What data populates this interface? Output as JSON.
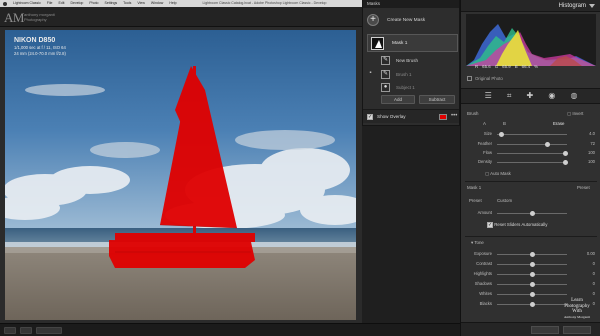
{
  "menubar": {
    "items": [
      "Lightroom Classic",
      "File",
      "Edit",
      "Develop",
      "Photo",
      "Settings",
      "Tools",
      "View",
      "Window",
      "Help"
    ],
    "window_title": "Lightroom Classic Catalog.lrcat - Adobe Photoshop Lightroom Classic - Develop"
  },
  "identity": {
    "mark": "AM",
    "name_line1": "anthony morganti",
    "name_line2": "Photography"
  },
  "photo_info": {
    "camera": "NIKON D850",
    "exposure": "1/1,000 sec at f / 11, ISO 64",
    "lens": "24 mm (24.0-70.0 mm f/2.8)"
  },
  "masks": {
    "panel_title": "Masks",
    "create_new_label": "Create New Mask",
    "mask_name": "Mask 1",
    "new_brush_label": "New Brush",
    "components": [
      "Brush 1",
      "Subject 1"
    ],
    "add_label": "Add",
    "subtract_label": "Subtract",
    "show_overlay_label": "Show Overlay",
    "show_overlay_checked": true,
    "overlay_color": "#e00000"
  },
  "histogram": {
    "title": "Histogram",
    "readout": [
      "R",
      "65.6",
      "G",
      "65.9",
      "B",
      "66.4",
      "%"
    ],
    "original_photo_label": "Original Photo"
  },
  "brush": {
    "title": "Brush",
    "invert_label": "Invert",
    "tabs": [
      "A",
      "B",
      "Erase"
    ],
    "sliders": [
      {
        "label": "Size",
        "value": "4.0",
        "position": 0.05
      },
      {
        "label": "Feather",
        "value": "72",
        "position": 0.72
      },
      {
        "label": "Flow",
        "value": "100",
        "position": 1.0
      },
      {
        "label": "Density",
        "value": "100",
        "position": 1.0
      }
    ],
    "auto_mask_label": "Auto Mask"
  },
  "mask_adjust": {
    "mask_label": "Mask 1",
    "preset_label": "Preset",
    "custom_label": "Custom",
    "amount_label": "Amount",
    "amount_position": 0.5,
    "reset_label": "Reset Sliders Automatically"
  },
  "tone": {
    "title": "Tone",
    "sliders": [
      {
        "label": "Exposure",
        "value": "0.00",
        "position": 0.5
      },
      {
        "label": "Contrast",
        "value": "0",
        "position": 0.5
      },
      {
        "label": "Highlights",
        "value": "0",
        "position": 0.5
      },
      {
        "label": "Shadows",
        "value": "0",
        "position": 0.5
      },
      {
        "label": "Whites",
        "value": "0",
        "position": 0.5
      },
      {
        "label": "Blacks",
        "value": "0",
        "position": 0.5
      }
    ]
  },
  "watermark": {
    "line1": "Learn",
    "line2": "Photography",
    "line3": "With",
    "line4": "Anthony Morganti"
  }
}
